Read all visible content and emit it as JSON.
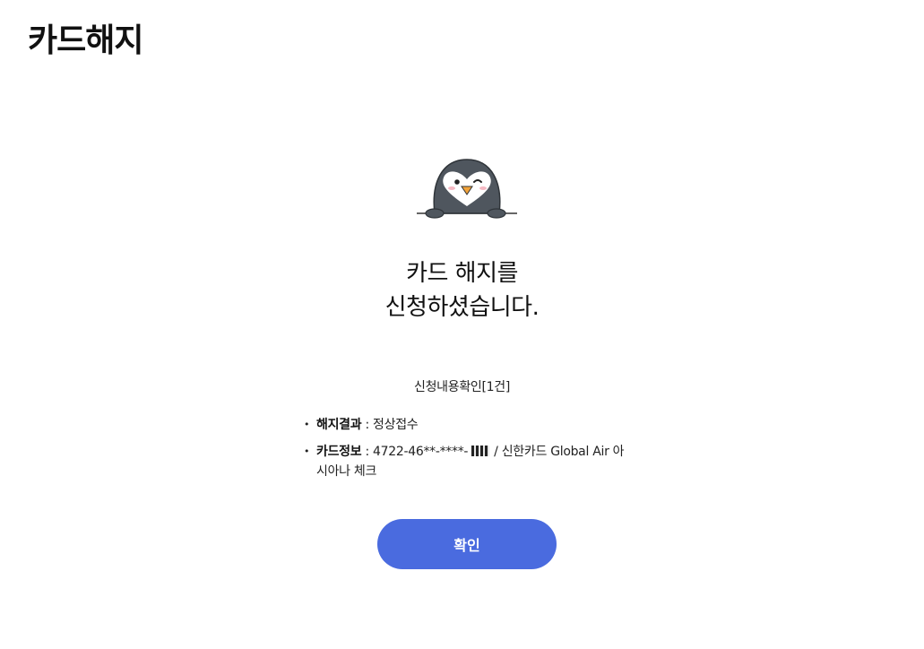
{
  "page": {
    "title": "카드해지"
  },
  "result": {
    "line1": "카드 해지를",
    "line2": "신청하셨습니다."
  },
  "summary": {
    "text": "신청내용확인[1건]"
  },
  "details": [
    {
      "label": "해지결과",
      "value": "정상접수"
    },
    {
      "label": "카드정보",
      "value_prefix": "4722-46**-****-",
      "value_suffix": "/ 신한카드 Global Air 아시아나 체크"
    }
  ],
  "separator": " : ",
  "actions": {
    "confirm_label": "확인"
  },
  "colors": {
    "accent": "#4a6bdf",
    "mascot_body": "#4f565e"
  }
}
